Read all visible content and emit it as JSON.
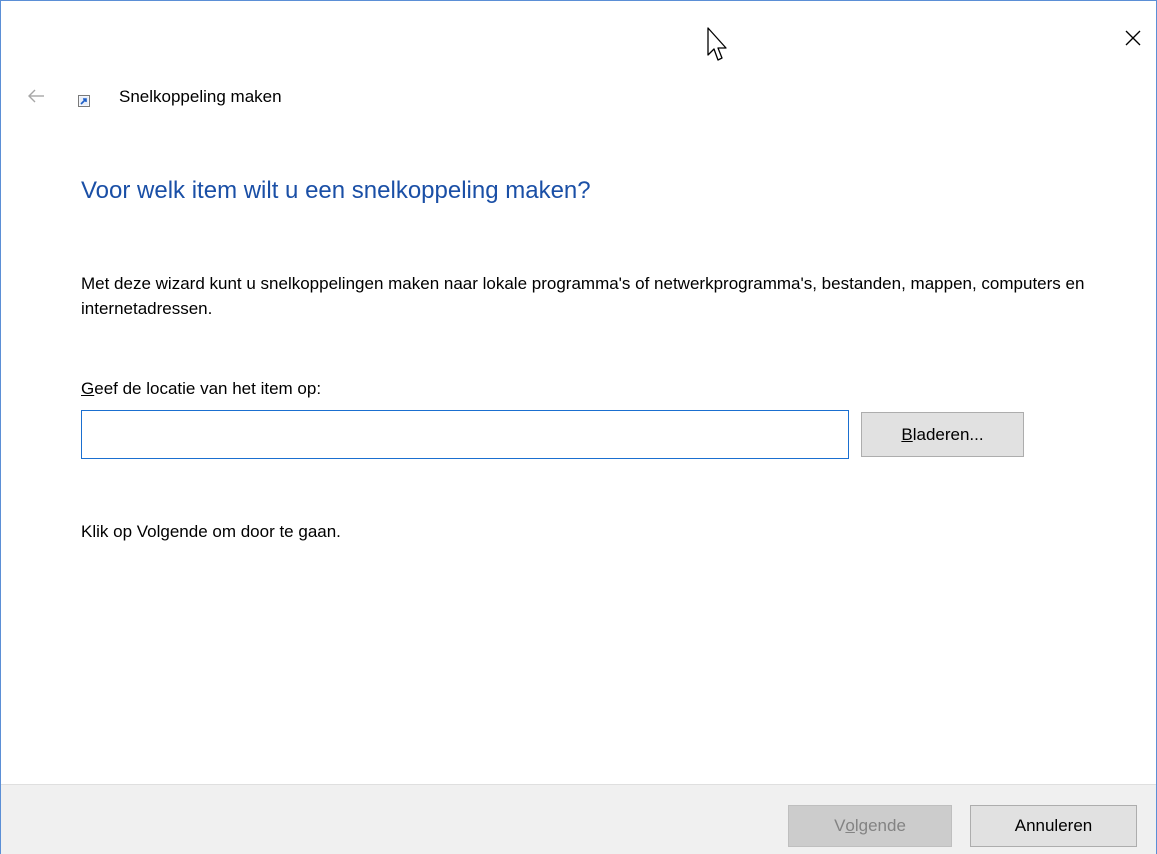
{
  "window": {
    "title": "Snelkoppeling maken",
    "close_icon": "close-icon",
    "back_icon": "back-arrow-icon",
    "app_icon": "shortcut-icon"
  },
  "main": {
    "heading": "Voor welk item wilt u een snelkoppeling maken?",
    "description": "Met deze wizard kunt u snelkoppelingen maken naar lokale programma's of netwerkprogramma's, bestanden, mappen, computers en internetadressen.",
    "location_label_accel": "G",
    "location_label_rest": "eef de locatie van het item op:",
    "location_value": "",
    "browse_accel": "B",
    "browse_rest": "laderen...",
    "hint": "Klik op Volgende om door te gaan."
  },
  "footer": {
    "next_pre": "V",
    "next_accel": "o",
    "next_rest": "lgende",
    "next_enabled": false,
    "cancel_label": "Annuleren"
  },
  "colors": {
    "heading": "#1a4fa6",
    "input_border": "#1a6fd0",
    "window_border": "#5b8fd6",
    "footer_bg": "#f0f0f0"
  }
}
